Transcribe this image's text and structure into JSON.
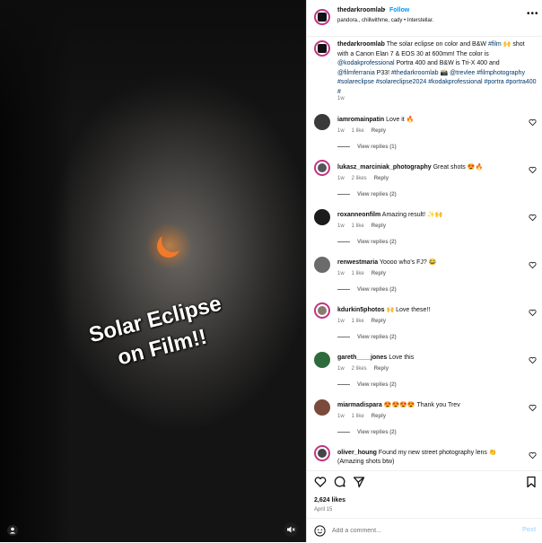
{
  "overlay": {
    "line1": "Solar Eclipse",
    "line2": "on Film!!"
  },
  "header": {
    "username": "thedarkroomlab",
    "separator": "•",
    "follow_label": "Follow",
    "subtitle": "pandora., chillwithme, cady • Interstellar."
  },
  "caption": {
    "username": "thedarkroomlab",
    "t1": " The solar eclipse on color and B&W ",
    "h1": "#film",
    "t2": " 🙌 shot with a Canon Elan 7 & EOS 30 at 600mm! The color is ",
    "m1": "@kodakprofessional",
    "t3": " Portra 400 and B&W is Tri-X 400 and ",
    "m2": "@filmferrania",
    "t4": " P33! ",
    "h2": "#thedarkroomlab",
    "t5": " 📸 ",
    "m3": "@trevlee",
    "h3": "#filmphotography",
    "h4": "#solareclipse",
    "h5": "#solareclipse2024",
    "h6": "#kodakprofessional",
    "h7": "#portra",
    "h8": "#portra400",
    "h9": "#",
    "time": "1w"
  },
  "comments": [
    {
      "user": "iamromainpatin",
      "text": "Love it 🔥",
      "time": "1w",
      "likes": "1 like",
      "reply": "Reply",
      "view_replies": "View replies (1)"
    },
    {
      "user": "lukasz_marciniak_photography",
      "text": "Great shots 😍🔥",
      "time": "1w",
      "likes": "2 likes",
      "reply": "Reply",
      "view_replies": "View replies (2)"
    },
    {
      "user": "roxanneonfilm",
      "text": "Amazing result! ✨🙌",
      "time": "1w",
      "likes": "1 like",
      "reply": "Reply",
      "view_replies": "View replies (2)"
    },
    {
      "user": "renwestmaria",
      "text": "Yoooo who's FJ? 😂",
      "time": "1w",
      "likes": "1 like",
      "reply": "Reply",
      "view_replies": "View replies (2)"
    },
    {
      "user": "kdurkin5photos",
      "text": "🙌 Love these!!",
      "time": "1w",
      "likes": "1 like",
      "reply": "Reply",
      "view_replies": "View replies (2)"
    },
    {
      "user": "gareth____jones",
      "text": "Love this",
      "time": "1w",
      "likes": "2 likes",
      "reply": "Reply",
      "view_replies": "View replies (2)"
    },
    {
      "user": "miarmadispara",
      "text": "😍😍😍😍 Thank you Trev",
      "time": "1w",
      "likes": "1 like",
      "reply": "Reply",
      "view_replies": "View replies (2)"
    },
    {
      "user": "oliver_houng",
      "text": "Found my new street photography lens 👏 (Amazing shots btw)",
      "time": "1w",
      "likes": "",
      "reply": "",
      "view_replies": ""
    }
  ],
  "actions": {
    "likes": "2,624 likes",
    "date": "April 15"
  },
  "add_comment": {
    "placeholder": "Add a comment...",
    "post_label": "Post"
  },
  "colors": {
    "accent": "#0095f6",
    "tag": "#00376b",
    "eclipse": "#e8782a"
  },
  "icons": [
    "heart-icon",
    "comment-icon",
    "share-icon",
    "bookmark-icon",
    "emoji-icon",
    "more-icon",
    "user-tag-icon",
    "audio-muted-icon"
  ]
}
